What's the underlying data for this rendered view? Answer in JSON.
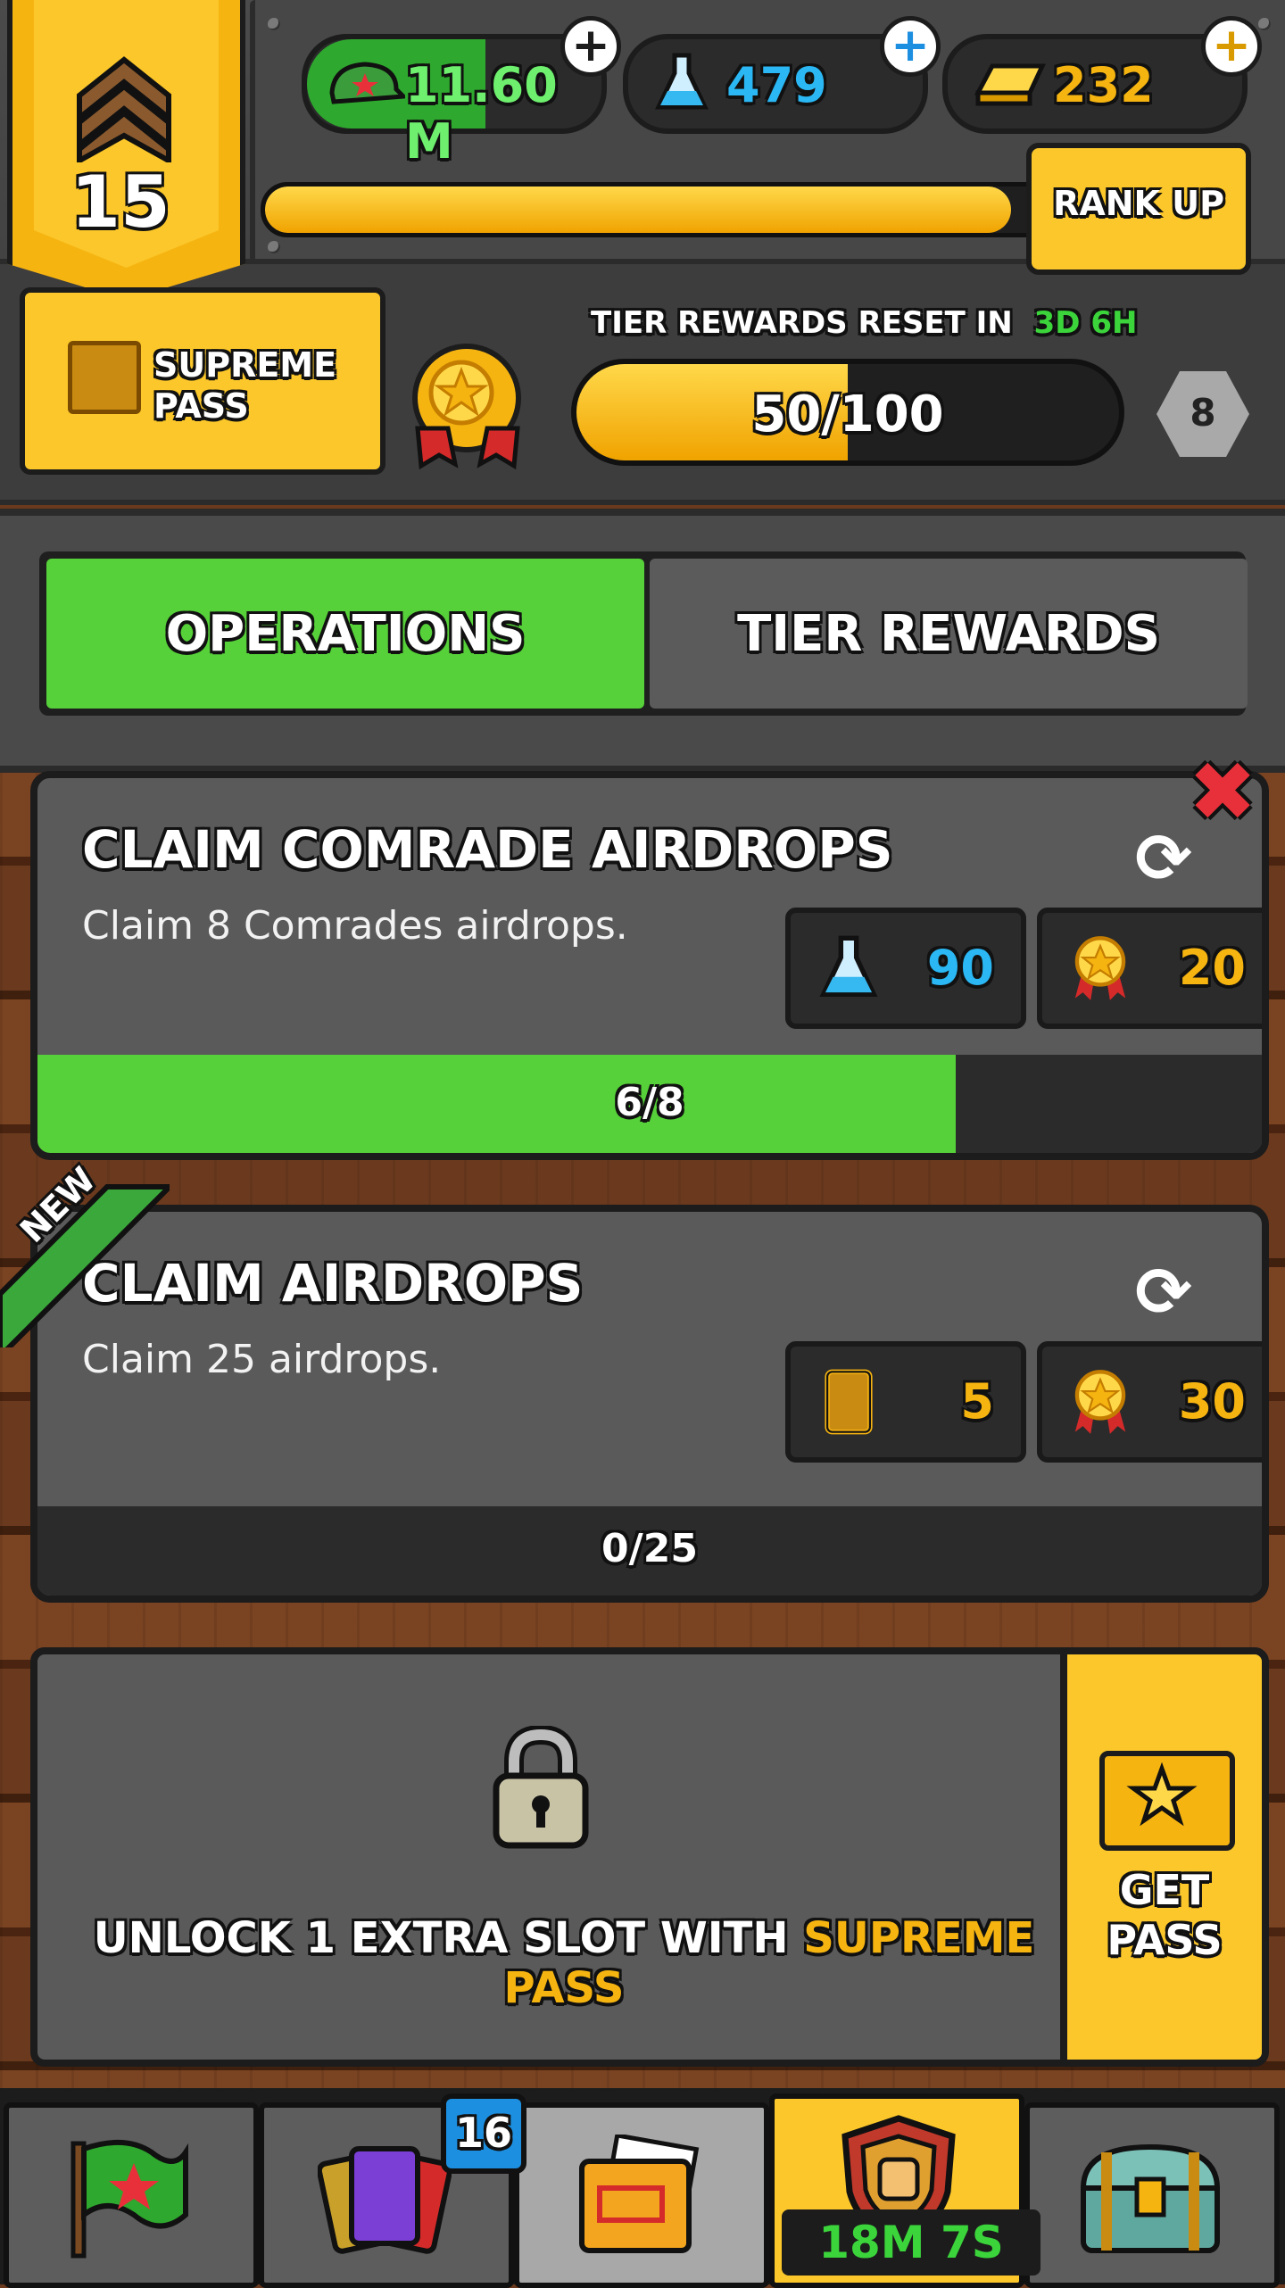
{
  "header": {
    "rank": "15",
    "currencies": [
      {
        "icon": "army-cap-icon",
        "value": "11.60 M"
      },
      {
        "icon": "flask-icon",
        "value": "479"
      },
      {
        "icon": "gold-bar-icon",
        "value": "232"
      }
    ],
    "xp_progress": 0.95,
    "rank_up_label": "RANK UP"
  },
  "pass": {
    "label_line1": "SUPREME",
    "label_line2": "PASS"
  },
  "tier": {
    "reset_label": "TIER REWARDS RESET IN",
    "reset_time": "3D 6H",
    "progress_text": "50/100",
    "progress": 0.5,
    "tier_number": "8"
  },
  "tabs": {
    "operations": "OPERATIONS",
    "tier_rewards": "TIER REWARDS"
  },
  "operations": [
    {
      "title": "CLAIM COMRADE AIRDROPS",
      "description": "Claim 8 Comrades airdrops.",
      "rewards": [
        {
          "icon": "flask-icon",
          "amount": "90",
          "color": "#2ab7f3"
        },
        {
          "icon": "medal-icon",
          "amount": "20",
          "color": "#f6b411"
        }
      ],
      "progress_text": "6/8",
      "progress": 0.75,
      "is_new": false
    },
    {
      "title": "CLAIM AIRDROPS",
      "description": "Claim 25 airdrops.",
      "rewards": [
        {
          "icon": "card-icon",
          "amount": "5",
          "color": "#f6b411"
        },
        {
          "icon": "medal-icon",
          "amount": "30",
          "color": "#f6b411"
        }
      ],
      "progress_text": "0/25",
      "progress": 0,
      "is_new": true,
      "new_label": "NEW"
    }
  ],
  "locked_slot": {
    "message_prefix": "UNLOCK 1 EXTRA SLOT WITH ",
    "message_highlight": "SUPREME PASS",
    "get_pass_line1": "GET",
    "get_pass_line2": "PASS"
  },
  "nav": {
    "cards_badge": "16",
    "timer": "18M 7S",
    "items": [
      "flag-icon",
      "cards-icon",
      "folder-icon",
      "shield-fist-icon",
      "chest-icon"
    ]
  },
  "colors": {
    "accent_green": "#56d139",
    "accent_yellow": "#fbc72a",
    "close_red": "#e8303a"
  }
}
